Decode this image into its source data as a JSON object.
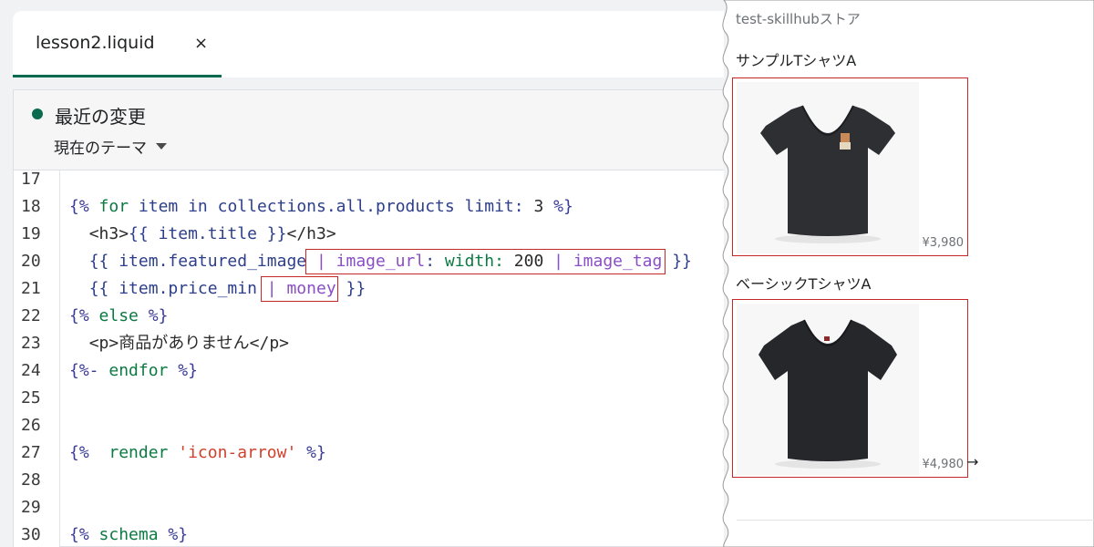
{
  "editor": {
    "tab": {
      "label": "lesson2.liquid",
      "close": "×"
    },
    "status": {
      "label": "最近の変更",
      "color": "#0b6b4f"
    },
    "theme_select": {
      "value": "現在のテーマ"
    },
    "line_numbers": [
      "17",
      "18",
      "19",
      "20",
      "21",
      "22",
      "23",
      "24",
      "25",
      "26",
      "27",
      "28",
      "29",
      "30"
    ],
    "code": {
      "l18": {
        "open": "{%",
        "kw": "for",
        "a": "item",
        "b": "in",
        "c": "collections.all.products",
        "d": "limit:",
        "e": "3",
        "close": "%}"
      },
      "l19": {
        "t1": "<h3>",
        "o": "{{",
        "v": "item.title",
        "c": "}}",
        "t2": "</h3>"
      },
      "l20": {
        "o": "{{",
        "v": "item.featured_image",
        "p1": "|",
        "f1": "image_url",
        "colon": ":",
        "k": "width:",
        "n": "200",
        "p2": "|",
        "f2": "image_tag",
        "c": "}}"
      },
      "l21": {
        "o": "{{",
        "v": "item.price_min",
        "p": "|",
        "f": "money",
        "c": "}}"
      },
      "l22": {
        "open": "{%",
        "kw": "else",
        "close": "%}"
      },
      "l23": {
        "t1": "<p>",
        "text": "商品がありません",
        "t2": "</p>"
      },
      "l24": {
        "open": "{%-",
        "kw": "endfor",
        "close": "%}"
      },
      "l27": {
        "open": "{%",
        "kw": "render",
        "str": "'icon-arrow'",
        "close": "%}"
      },
      "l30": {
        "open": "{%",
        "kw": "schema",
        "close": "%}"
      }
    }
  },
  "preview": {
    "store_name": "test-skillhubストア",
    "products": [
      {
        "title": "サンプルTシャツA",
        "price": "¥3,980"
      },
      {
        "title": "ベーシックTシャツA",
        "price": "¥4,980"
      }
    ],
    "arrow": "→",
    "highlight_color": "#c62828"
  }
}
